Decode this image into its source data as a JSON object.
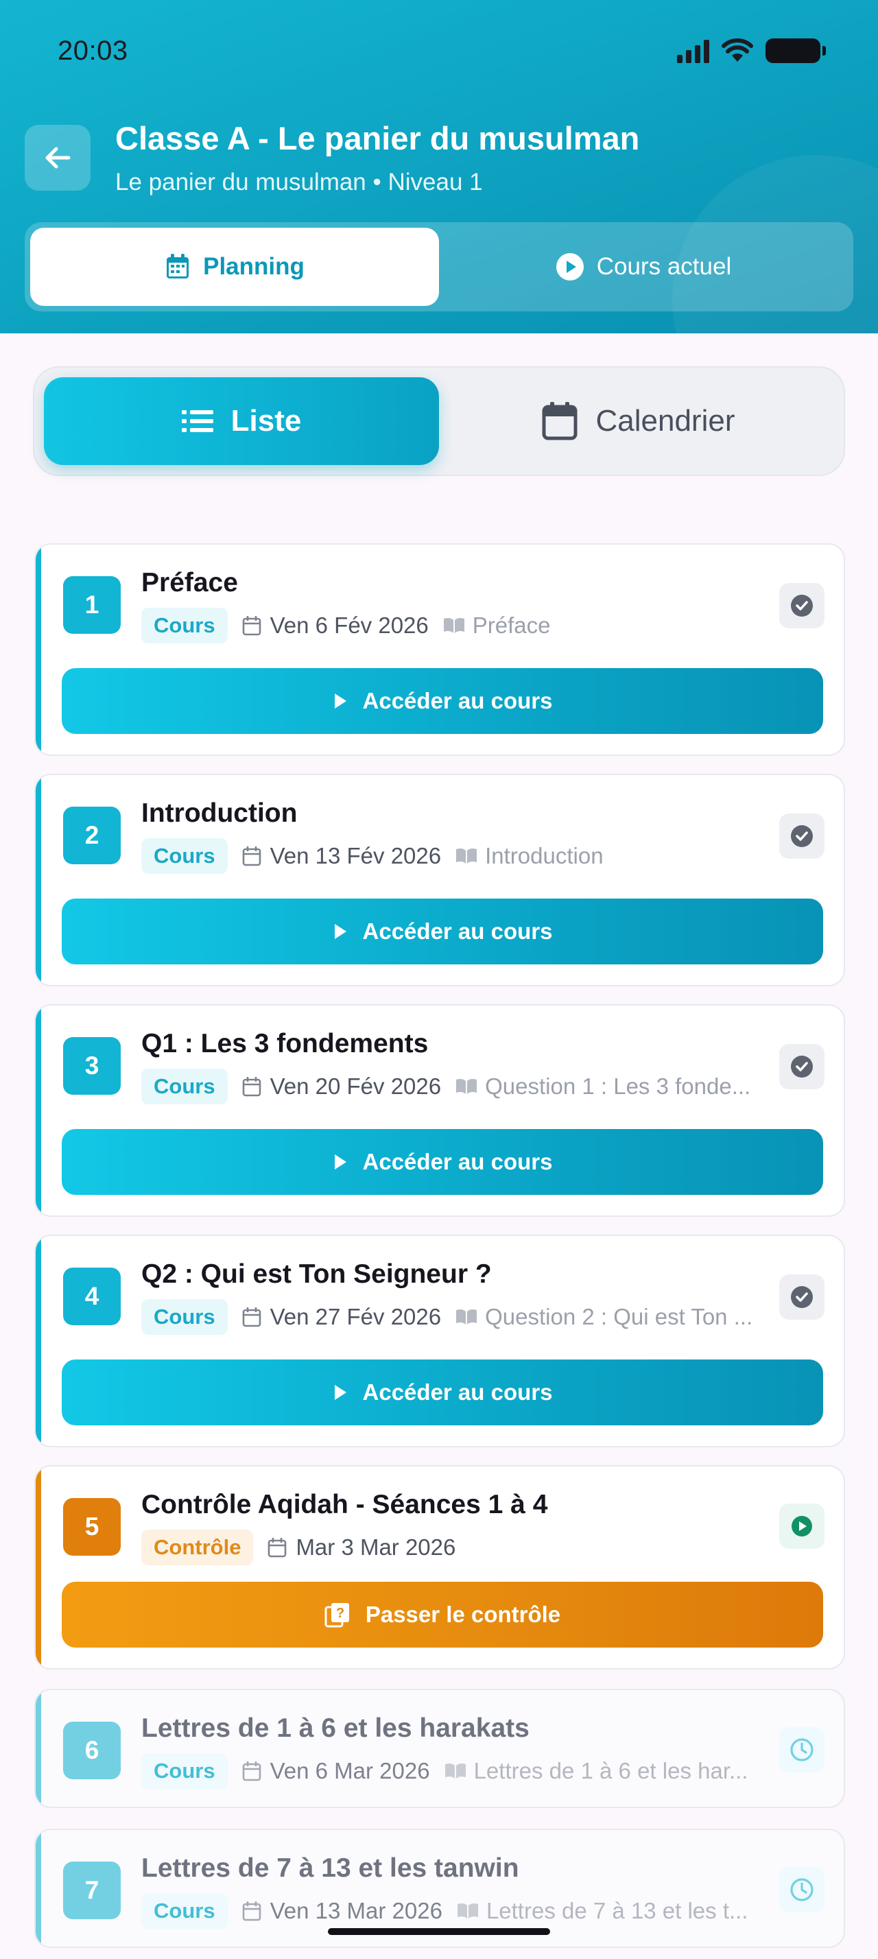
{
  "status_bar": {
    "time": "20:03"
  },
  "header": {
    "title": "Classe A - Le panier du musulman",
    "subtitle": "Le panier du musulman • Niveau 1",
    "tabs": [
      {
        "label": "Planning",
        "icon": "calendar-icon",
        "active": true
      },
      {
        "label": "Cours actuel",
        "icon": "play-circle-icon",
        "active": false
      }
    ]
  },
  "view_toggle": {
    "list_label": "Liste",
    "calendar_label": "Calendrier",
    "active": "Liste"
  },
  "colors": {
    "teal": "#0ea5c3",
    "teal_light": "#12c5e3",
    "orange": "#e58a0e",
    "future_teal": "#73d0e3"
  },
  "sessions": [
    {
      "number": "1",
      "title": "Préface",
      "type": "Cours",
      "date": "Ven 6 Fév 2026",
      "reference": "Préface",
      "status": "completed",
      "action": "Accéder au cours"
    },
    {
      "number": "2",
      "title": "Introduction",
      "type": "Cours",
      "date": "Ven 13 Fév 2026",
      "reference": "Introduction",
      "status": "completed",
      "action": "Accéder au cours"
    },
    {
      "number": "3",
      "title": "Q1 : Les 3 fondements",
      "type": "Cours",
      "date": "Ven 20 Fév 2026",
      "reference": "Question 1 : Les 3 fonde...",
      "status": "completed",
      "action": "Accéder au cours"
    },
    {
      "number": "4",
      "title": "Q2 : Qui est Ton Seigneur ?",
      "type": "Cours",
      "date": "Ven 27 Fév 2026",
      "reference": "Question 2 : Qui est Ton ...",
      "status": "completed",
      "action": "Accéder au cours"
    },
    {
      "number": "5",
      "title": "Contrôle Aqidah - Séances 1 à 4",
      "type": "Contrôle",
      "date": "Mar 3 Mar 2026",
      "reference": "",
      "status": "current",
      "action": "Passer le contrôle"
    },
    {
      "number": "6",
      "title": "Lettres de 1 à 6 et les harakats",
      "type": "Cours",
      "date": "Ven 6 Mar 2026",
      "reference": "Lettres de 1 à 6 et les har...",
      "status": "upcoming",
      "action": ""
    },
    {
      "number": "7",
      "title": "Lettres de 7 à 13 et les tanwin",
      "type": "Cours",
      "date": "Ven 13 Mar 2026",
      "reference": "Lettres de 7 à 13 et les t...",
      "status": "upcoming",
      "action": ""
    }
  ]
}
